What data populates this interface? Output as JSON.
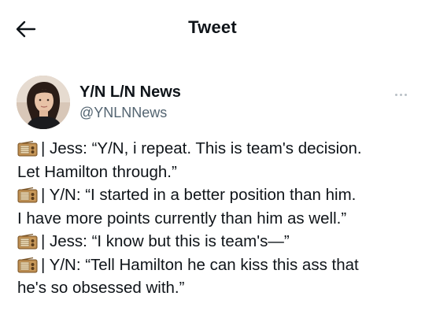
{
  "header": {
    "title": "Tweet",
    "back_icon": "back-arrow-icon"
  },
  "tweet": {
    "author": {
      "display_name": "Y/N L/N News",
      "handle": "@YNLNNews",
      "avatar": "avatar-photo"
    },
    "more_icon": "more-options-icon",
    "emoji_icon": "radio-icon",
    "body_lines": [
      {
        "icon": true,
        "text": "| Jess: “Y/N, i repeat. This is team's decision."
      },
      {
        "icon": false,
        "text": "Let Hamilton through.”"
      },
      {
        "icon": true,
        "text": "| Y/N: “I started in a better position than him."
      },
      {
        "icon": false,
        "text": "I have more points currently than him as well.”"
      },
      {
        "icon": true,
        "text": "| Jess: “I know but this is team's—”"
      },
      {
        "icon": true,
        "text": "| Y/N: “Tell Hamilton he can kiss this ass that"
      },
      {
        "icon": false,
        "text": "he's so obsessed with.”"
      }
    ]
  },
  "colors": {
    "text": "#0f1419",
    "secondary_text": "#536471",
    "background": "#ffffff"
  }
}
